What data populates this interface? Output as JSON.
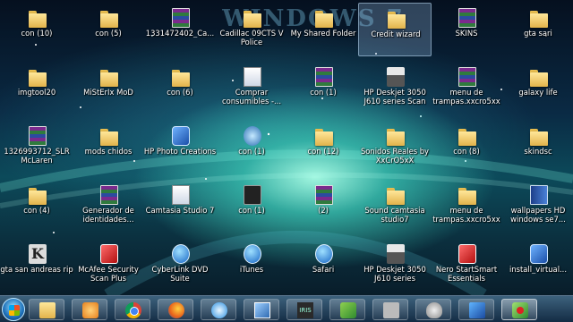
{
  "wallpaper": {
    "text": "WINDOWS 7"
  },
  "desktop_icons": [
    {
      "label": "con (10)",
      "icon": "folder-icon",
      "selected": false
    },
    {
      "label": "con (5)",
      "icon": "folder-icon",
      "selected": false
    },
    {
      "label": "1331472402_Ca...",
      "icon": "winrar-archive-icon",
      "selected": false
    },
    {
      "label": "Cadillac 09CTS V Police",
      "icon": "folder-icon",
      "selected": false
    },
    {
      "label": "My Shared Folder",
      "icon": "shared-folder-icon",
      "selected": false
    },
    {
      "label": "Credit wizard",
      "icon": "folder-icon",
      "selected": true
    },
    {
      "label": "SKINS",
      "icon": "winrar-archive-icon",
      "selected": false
    },
    {
      "label": "gta sari",
      "icon": "folder-icon",
      "selected": false
    },
    {
      "label": "imgtool20",
      "icon": "folder-icon",
      "selected": false
    },
    {
      "label": "MiStErIx MoD",
      "icon": "folder-icon",
      "selected": false
    },
    {
      "label": "con (6)",
      "icon": "folder-icon",
      "selected": false
    },
    {
      "label": "Comprar consumibles -...",
      "icon": "document-icon",
      "selected": false
    },
    {
      "label": "con (1)",
      "icon": "winrar-archive-icon",
      "selected": false
    },
    {
      "label": "HP Deskjet 3050 J610 series Scan",
      "icon": "printer-icon",
      "selected": false
    },
    {
      "label": "menu de trampas.xxcro5xx",
      "icon": "winrar-archive-icon",
      "selected": false
    },
    {
      "label": "galaxy life",
      "icon": "folder-icon",
      "selected": false
    },
    {
      "label": "1326993712_SLR McLaren",
      "icon": "winrar-archive-icon",
      "selected": false
    },
    {
      "label": "mods chidos",
      "icon": "folder-icon",
      "selected": false
    },
    {
      "label": "HP Photo Creations",
      "icon": "hp-photo-icon",
      "selected": false
    },
    {
      "label": "con (1)",
      "icon": "sound-file-icon",
      "selected": false
    },
    {
      "label": "con (12)",
      "icon": "folder-icon",
      "selected": false
    },
    {
      "label": "Sonidos Reales by XxCrO5xX",
      "icon": "folder-icon",
      "selected": false
    },
    {
      "label": "con (8)",
      "icon": "folder-icon",
      "selected": false
    },
    {
      "label": "skindsc",
      "icon": "folder-icon",
      "selected": false
    },
    {
      "label": "con (4)",
      "icon": "folder-icon",
      "selected": false
    },
    {
      "label": "Generador de identidades...",
      "icon": "winrar-archive-icon",
      "selected": false
    },
    {
      "label": "Camtasia Studio 7",
      "icon": "camtasia-icon",
      "selected": false
    },
    {
      "label": "con (1)",
      "icon": "video-file-icon",
      "selected": false
    },
    {
      "label": "(2)",
      "icon": "winrar-archive-icon",
      "selected": false
    },
    {
      "label": "Sound camtasia studio7",
      "icon": "folder-icon",
      "selected": false
    },
    {
      "label": "menu de trampas.xxcro5xx",
      "icon": "folder-icon",
      "selected": false
    },
    {
      "label": "wallpapers HD windows se7...",
      "icon": "wallpapers-book-icon",
      "selected": false
    },
    {
      "label": "gta san andreas rip",
      "icon": "k-app-icon",
      "selected": false
    },
    {
      "label": "McAfee Security Scan Plus",
      "icon": "mcafee-icon",
      "selected": false
    },
    {
      "label": "CyberLink DVD Suite",
      "icon": "cyberlink-icon",
      "selected": false
    },
    {
      "label": "iTunes",
      "icon": "itunes-icon",
      "selected": false
    },
    {
      "label": "Safari",
      "icon": "safari-icon",
      "selected": false
    },
    {
      "label": "HP Deskjet 3050 J610 series",
      "icon": "printer-icon",
      "selected": false
    },
    {
      "label": "Nero StartSmart Essentials",
      "icon": "nero-icon",
      "selected": false
    },
    {
      "label": "install_virtual...",
      "icon": "installer-icon",
      "selected": false
    }
  ],
  "taskbar": {
    "start": "windows-start-icon",
    "items": [
      {
        "name": "windows-explorer",
        "icon": "ti explorer"
      },
      {
        "name": "windows-media-player",
        "icon": "ti media"
      },
      {
        "name": "google-chrome",
        "icon": "ti chrome"
      },
      {
        "name": "firefox",
        "icon": "ti firefox"
      },
      {
        "name": "safari",
        "icon": "ti safari"
      },
      {
        "name": "show-desktop",
        "icon": "ti desktop"
      },
      {
        "name": "game-launcher",
        "icon": "ti game",
        "text": "IRIS"
      },
      {
        "name": "live-messenger",
        "icon": "ti wlm"
      },
      {
        "name": "user-photo",
        "icon": "ti photo"
      },
      {
        "name": "mouse-settings",
        "icon": "ti mouse"
      },
      {
        "name": "network-app",
        "icon": "ti network"
      },
      {
        "name": "camtasia-recorder",
        "icon": "ti camtasia",
        "active": true
      }
    ]
  }
}
